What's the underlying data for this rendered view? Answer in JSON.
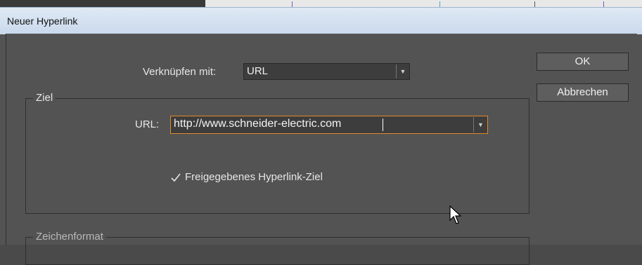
{
  "window": {
    "title": "Neuer Hyperlink"
  },
  "link_with": {
    "label": "Verknüpfen mit:",
    "value": "URL"
  },
  "buttons": {
    "ok": "OK",
    "cancel": "Abbrechen"
  },
  "target_group": {
    "legend": "Ziel",
    "url_label": "URL:",
    "url_value": "http://www.schneider-electric.com",
    "shared_checkbox": {
      "label": "Freigegebenes Hyperlink-Ziel",
      "checked": true
    }
  },
  "character_format_group": {
    "legend": "Zeichenformat"
  }
}
